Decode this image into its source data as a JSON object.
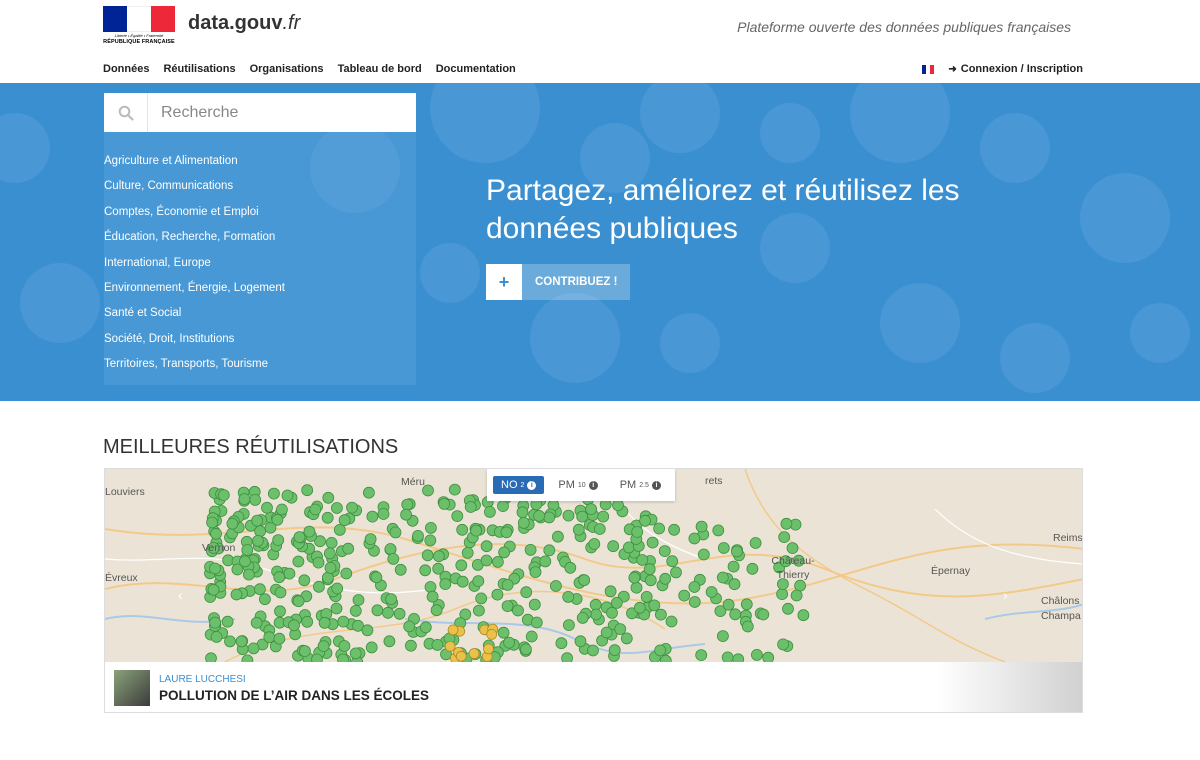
{
  "header": {
    "marianne": {
      "motto": "Liberté • Égalité • Fraternité",
      "republic": "RÉPUBLIQUE FRANÇAISE"
    },
    "site_name": "data.gouv",
    "site_tld": ".fr",
    "tagline": "Plateforme ouverte des données publiques françaises",
    "nav": [
      "Données",
      "Réutilisations",
      "Organisations",
      "Tableau de bord",
      "Documentation"
    ],
    "login": "Connexion / Inscription",
    "colors": {
      "flag_blue": "#002395",
      "flag_white": "#ffffff",
      "flag_red": "#ed2939"
    }
  },
  "hero": {
    "search_placeholder": "Recherche",
    "topics": [
      "Agriculture et Alimentation",
      "Culture, Communications",
      "Comptes, Économie et Emploi",
      "Éducation, Recherche, Formation",
      "International, Europe",
      "Environnement, Énergie, Logement",
      "Santé et Social",
      "Société, Droit, Institutions",
      "Territoires, Transports, Tourisme"
    ],
    "title": "Partagez, améliorez et réutilisez les données publiques",
    "contribute_icon": "+",
    "contribute_label": "CONTRIBUEZ !",
    "background_color": "#3a8fd1"
  },
  "reuses": {
    "section_title": "MEILLEURES RÉUTILISATIONS",
    "map": {
      "place_labels": [
        "Louviers",
        "Méru",
        "Vernon",
        "Évreux",
        "Château-Thierry",
        "Épernay",
        "Reims",
        "Châlons",
        "Champa",
        "rets"
      ],
      "pollutant_tabs": [
        {
          "name": "NO",
          "sub": "2",
          "active": true
        },
        {
          "name": "PM",
          "sub": "10",
          "active": false
        },
        {
          "name": "PM",
          "sub": "2.5",
          "active": false
        }
      ],
      "prev_arrow": "‹",
      "next_arrow": "›",
      "marker_color": "#6cc06c"
    },
    "author": "LAURE LUCCHESI",
    "title": "POLLUTION DE L’AIR DANS LES ÉCOLES"
  }
}
